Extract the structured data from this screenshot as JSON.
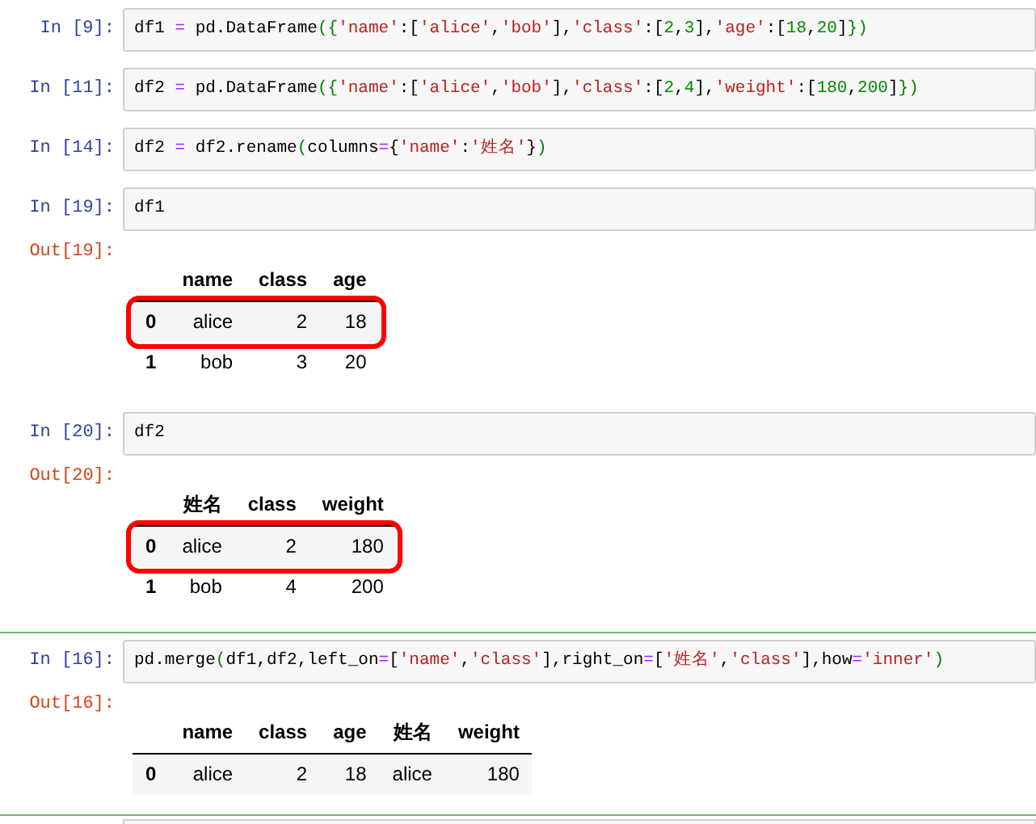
{
  "cells": [
    {
      "prompt": "In [9]:",
      "selected": false,
      "code": [
        {
          "kind": "plain",
          "text": "df1 "
        },
        {
          "kind": "op",
          "text": "="
        },
        {
          "kind": "plain",
          "text": " pd.DataFrame"
        },
        {
          "kind": "bracket",
          "text": "({"
        },
        {
          "kind": "str",
          "text": "'name'"
        },
        {
          "kind": "plain",
          "text": ":["
        },
        {
          "kind": "str",
          "text": "'alice'"
        },
        {
          "kind": "plain",
          "text": ","
        },
        {
          "kind": "str",
          "text": "'bob'"
        },
        {
          "kind": "plain",
          "text": "],"
        },
        {
          "kind": "str",
          "text": "'class'"
        },
        {
          "kind": "plain",
          "text": ":["
        },
        {
          "kind": "num",
          "text": "2"
        },
        {
          "kind": "plain",
          "text": ","
        },
        {
          "kind": "num",
          "text": "3"
        },
        {
          "kind": "plain",
          "text": "],"
        },
        {
          "kind": "str",
          "text": "'age'"
        },
        {
          "kind": "plain",
          "text": ":["
        },
        {
          "kind": "num",
          "text": "18"
        },
        {
          "kind": "plain",
          "text": ","
        },
        {
          "kind": "num",
          "text": "20"
        },
        {
          "kind": "plain",
          "text": "]"
        },
        {
          "kind": "bracket",
          "text": "})"
        }
      ]
    },
    {
      "prompt": "In [11]:",
      "selected": false,
      "code": [
        {
          "kind": "plain",
          "text": "df2 "
        },
        {
          "kind": "op",
          "text": "="
        },
        {
          "kind": "plain",
          "text": " pd.DataFrame"
        },
        {
          "kind": "bracket",
          "text": "({"
        },
        {
          "kind": "str",
          "text": "'name'"
        },
        {
          "kind": "plain",
          "text": ":["
        },
        {
          "kind": "str",
          "text": "'alice'"
        },
        {
          "kind": "plain",
          "text": ","
        },
        {
          "kind": "str",
          "text": "'bob'"
        },
        {
          "kind": "plain",
          "text": "],"
        },
        {
          "kind": "str",
          "text": "'class'"
        },
        {
          "kind": "plain",
          "text": ":["
        },
        {
          "kind": "num",
          "text": "2"
        },
        {
          "kind": "plain",
          "text": ","
        },
        {
          "kind": "num",
          "text": "4"
        },
        {
          "kind": "plain",
          "text": "],"
        },
        {
          "kind": "str",
          "text": "'weight'"
        },
        {
          "kind": "plain",
          "text": ":["
        },
        {
          "kind": "num",
          "text": "180"
        },
        {
          "kind": "plain",
          "text": ","
        },
        {
          "kind": "num",
          "text": "200"
        },
        {
          "kind": "plain",
          "text": "]"
        },
        {
          "kind": "bracket",
          "text": "})"
        }
      ]
    },
    {
      "prompt": "In [14]:",
      "selected": false,
      "code": [
        {
          "kind": "plain",
          "text": "df2 "
        },
        {
          "kind": "op",
          "text": "="
        },
        {
          "kind": "plain",
          "text": " df2.rename"
        },
        {
          "kind": "bracket",
          "text": "("
        },
        {
          "kind": "plain",
          "text": "columns"
        },
        {
          "kind": "op",
          "text": "="
        },
        {
          "kind": "plain",
          "text": "{"
        },
        {
          "kind": "str",
          "text": "'name'"
        },
        {
          "kind": "plain",
          "text": ":"
        },
        {
          "kind": "str",
          "text": "'姓名'"
        },
        {
          "kind": "plain",
          "text": "}"
        },
        {
          "kind": "bracket",
          "text": ")"
        }
      ]
    },
    {
      "prompt": "In [19]:",
      "selected": false,
      "code": [
        {
          "kind": "plain",
          "text": "df1"
        }
      ],
      "output": {
        "prompt": "Out[19]:",
        "columns": [
          "name",
          "class",
          "age"
        ],
        "rows": [
          {
            "index": "0",
            "highlighted": true,
            "cells": [
              "alice",
              "2",
              "18"
            ]
          },
          {
            "index": "1",
            "highlighted": false,
            "cells": [
              "bob",
              "3",
              "20"
            ]
          }
        ]
      }
    },
    {
      "prompt": "In [20]:",
      "selected": false,
      "code": [
        {
          "kind": "plain",
          "text": "df2"
        }
      ],
      "output": {
        "prompt": "Out[20]:",
        "columns": [
          "姓名",
          "class",
          "weight"
        ],
        "rows": [
          {
            "index": "0",
            "highlighted": true,
            "cells": [
              "alice",
              "2",
              "180"
            ]
          },
          {
            "index": "1",
            "highlighted": false,
            "cells": [
              "bob",
              "4",
              "200"
            ]
          }
        ]
      }
    },
    {
      "prompt": "In [16]:",
      "selected": true,
      "code": [
        {
          "kind": "plain",
          "text": "pd.merge"
        },
        {
          "kind": "bracket",
          "text": "("
        },
        {
          "kind": "plain",
          "text": "df1,df2,left_on"
        },
        {
          "kind": "op",
          "text": "="
        },
        {
          "kind": "plain",
          "text": "["
        },
        {
          "kind": "str",
          "text": "'name'"
        },
        {
          "kind": "plain",
          "text": ","
        },
        {
          "kind": "str",
          "text": "'class'"
        },
        {
          "kind": "plain",
          "text": "],right_on"
        },
        {
          "kind": "op",
          "text": "="
        },
        {
          "kind": "plain",
          "text": "["
        },
        {
          "kind": "str",
          "text": "'姓名'"
        },
        {
          "kind": "plain",
          "text": ","
        },
        {
          "kind": "str",
          "text": "'class'"
        },
        {
          "kind": "plain",
          "text": "],how"
        },
        {
          "kind": "op",
          "text": "="
        },
        {
          "kind": "str",
          "text": "'inner'"
        },
        {
          "kind": "bracket",
          "text": ")"
        }
      ],
      "output": {
        "prompt": "Out[16]:",
        "columns": [
          "name",
          "class",
          "age",
          "姓名",
          "weight"
        ],
        "rows": [
          {
            "index": "0",
            "highlighted": false,
            "cells": [
              "alice",
              "2",
              "18",
              "alice",
              "180"
            ]
          }
        ]
      }
    }
  ]
}
